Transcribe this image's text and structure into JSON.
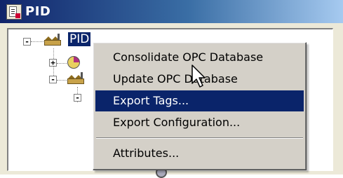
{
  "window": {
    "title": "PID"
  },
  "tree": {
    "root": {
      "label": "PID",
      "expanded": true
    },
    "toggles": [
      "-",
      "+",
      "-",
      "-"
    ]
  },
  "context_menu": {
    "items": [
      {
        "label": "Consolidate OPC Database",
        "highlighted": false
      },
      {
        "label": "Update OPC Database",
        "highlighted": false
      },
      {
        "label": "Export Tags...",
        "highlighted": true
      },
      {
        "label": "Export Configuration...",
        "highlighted": false
      },
      {
        "label": "Attributes...",
        "highlighted": false
      }
    ]
  },
  "colors": {
    "title_bar": "#10246a",
    "menu_highlight": "#0a246a",
    "menu_bg": "#d4d0c8"
  }
}
